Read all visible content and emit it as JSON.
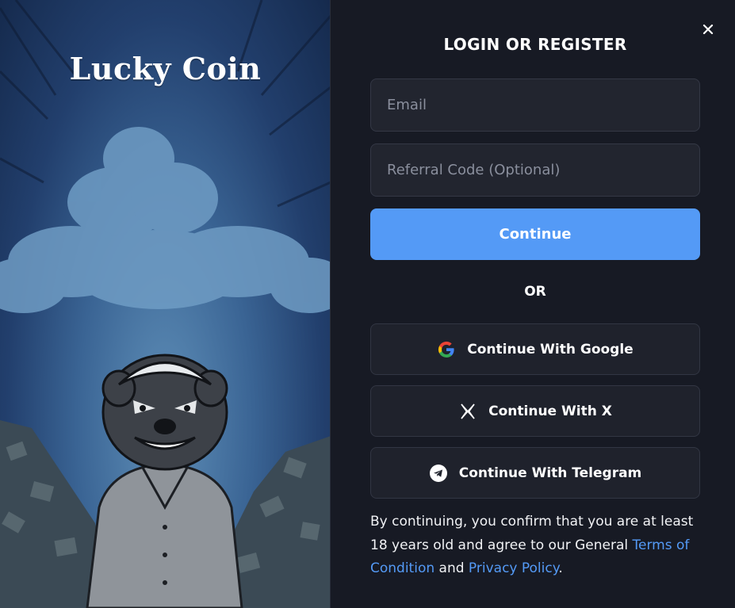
{
  "brand": {
    "logo_text": "Lucky Coin"
  },
  "modal": {
    "title": "LOGIN OR REGISTER",
    "close_label": "×"
  },
  "form": {
    "email_placeholder": "Email",
    "email_value": "",
    "referral_placeholder": "Referral Code (Optional)",
    "referral_value": "",
    "continue_label": "Continue",
    "or_label": "OR"
  },
  "social": [
    {
      "label": "Continue With Google",
      "icon": "google-icon"
    },
    {
      "label": "Continue With X",
      "icon": "x-icon"
    },
    {
      "label": "Continue With Telegram",
      "icon": "telegram-icon"
    }
  ],
  "legal": {
    "prefix": "By continuing, you confirm that you are at least 18 years old and agree to our General ",
    "terms_link": "Terms of Condition",
    "and": " and ",
    "privacy_link": "Privacy Policy",
    "suffix": "."
  },
  "colors": {
    "accent": "#549af6",
    "panel_bg": "#171a24",
    "field_bg": "#22252f",
    "button_bg": "#1f222c"
  }
}
